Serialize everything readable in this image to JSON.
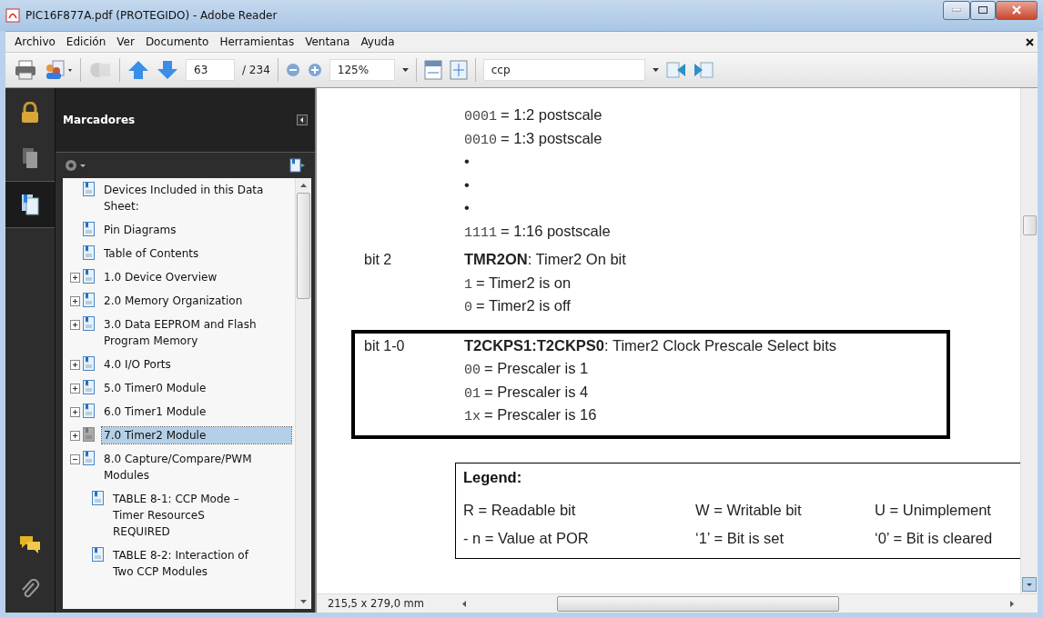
{
  "window": {
    "title": "PIC16F877A.pdf (PROTEGIDO) - Adobe Reader"
  },
  "menu": [
    "Archivo",
    "Edición",
    "Ver",
    "Documento",
    "Herramientas",
    "Ventana",
    "Ayuda"
  ],
  "toolbar": {
    "page_number": "63",
    "page_total": "/ 234",
    "zoom": "125%",
    "search": "ccp"
  },
  "sidebar": {
    "tabs": [
      {
        "kind": "lock",
        "selected": false
      },
      {
        "kind": "pages",
        "selected": false
      },
      {
        "kind": "bookmarks",
        "selected": true
      }
    ],
    "bottom_tabs": [
      {
        "kind": "comments",
        "selected": false
      },
      {
        "kind": "attachments",
        "selected": false
      }
    ],
    "panel_title": "Marcadores",
    "bookmarks": [
      {
        "label": "Devices Included in this Data Sheet:",
        "selected": false
      },
      {
        "label": "Pin Diagrams",
        "selected": false
      },
      {
        "label": "Table of Contents",
        "selected": false
      },
      {
        "label": "1.0 Device Overview",
        "selected": false,
        "expanded": false
      },
      {
        "label": "2.0 Memory Organization",
        "selected": false,
        "expanded": false
      },
      {
        "label": "3.0 Data EEPROM and Flash Program Memory",
        "selected": false,
        "expanded": false
      },
      {
        "label": "4.0 I/O Ports",
        "selected": false,
        "expanded": false
      },
      {
        "label": "5.0 Timer0 Module",
        "selected": false,
        "expanded": false
      },
      {
        "label": "6.0 Timer1 Module",
        "selected": false,
        "expanded": false
      },
      {
        "label": "7.0 Timer2 Module",
        "selected": true,
        "expanded": false
      },
      {
        "label": "8.0 Capture/Compare/PWM Modules",
        "selected": false,
        "expanded": true,
        "children": [
          {
            "label": "TABLE 8-1: CCP Mode – Timer ResourceS REQUIRED",
            "selected": false
          },
          {
            "label": "TABLE 8-2: Interaction of Two CCP Modules",
            "selected": false
          }
        ]
      }
    ]
  },
  "document": {
    "sections": [
      {
        "boxed": false,
        "rows": [
          {
            "code": "0001",
            "text": "= 1:2 postscale"
          },
          {
            "code": "0010",
            "text": "= 1:3 postscale"
          },
          {
            "text": "•"
          },
          {
            "text": "•"
          },
          {
            "text": "•"
          },
          {
            "code": "1111",
            "text": "= 1:16 postscale"
          }
        ]
      },
      {
        "boxed": false,
        "rows": [
          {
            "label": "bit 2",
            "text": "**TMR2ON**: Timer2 On bit"
          },
          {
            "code": "1",
            "text": "= Timer2 is on"
          },
          {
            "code": "0",
            "text": "= Timer2 is off"
          }
        ]
      },
      {
        "boxed": true,
        "rows": [
          {
            "label": "bit 1-0",
            "text": "**T2CKPS1:T2CKPS0**: Timer2 Clock Prescale Select bits"
          },
          {
            "code": "00",
            "text": "= Prescaler is 1"
          },
          {
            "code": "01",
            "text": "= Prescaler is 4"
          },
          {
            "code": "1x",
            "text": "= Prescaler is 16"
          }
        ]
      }
    ],
    "legend": {
      "title": "Legend:",
      "rows": [
        [
          "R = Readable bit",
          "W = Writable bit",
          "U = Unimplement"
        ],
        [
          "- n = Value at POR",
          "‘1’ = Bit is set",
          "‘0’ = Bit is cleared"
        ]
      ]
    }
  },
  "status_bar": {
    "page_size": "215,5 x 279,0 mm"
  }
}
